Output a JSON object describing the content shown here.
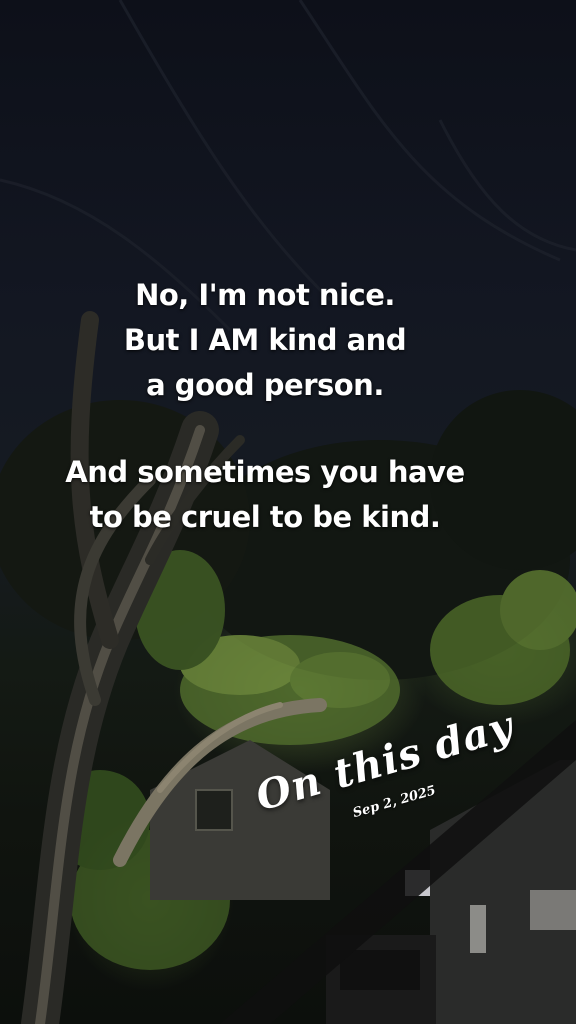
{
  "caption": {
    "block1": [
      "No, I'm not nice.",
      "But I AM kind and",
      "a good person."
    ],
    "block2": [
      "And sometimes you have",
      "to be cruel to be kind."
    ]
  },
  "sticker": {
    "title": "On this day",
    "date": "Sep 2, 2025"
  },
  "scene": {
    "icon": "night-tree-photo",
    "colors": {
      "sky": "#131722",
      "foliage": "#6e8a3c",
      "branch": "#8c8470",
      "house": "#3a3a36"
    }
  }
}
